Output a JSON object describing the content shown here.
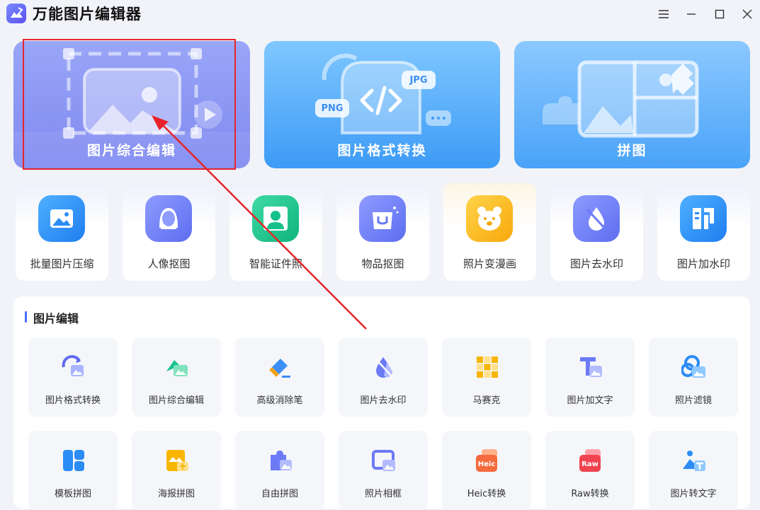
{
  "app": {
    "title": "万能图片编辑器"
  },
  "hero": [
    {
      "label": "图片综合编辑"
    },
    {
      "label": "图片格式转换",
      "badges": [
        "PNG",
        "JPG"
      ]
    },
    {
      "label": "拼图"
    }
  ],
  "tools": [
    {
      "label": "批量图片压缩",
      "icon": "image-compress-icon",
      "color": "#2b8cf5"
    },
    {
      "label": "人像抠图",
      "icon": "portrait-cutout-icon",
      "color": "#6b7af5"
    },
    {
      "label": "智能证件照",
      "icon": "id-photo-icon",
      "color": "#16c08a"
    },
    {
      "label": "物品抠图",
      "icon": "object-cutout-icon",
      "color": "#6b7af5"
    },
    {
      "label": "照片变漫画",
      "icon": "cartoon-bear-icon",
      "color": "#fbb918"
    },
    {
      "label": "图片去水印",
      "icon": "remove-watermark-icon",
      "color": "#6b7af5"
    },
    {
      "label": "图片加水印",
      "icon": "add-watermark-icon",
      "color": "#2b8cf5"
    }
  ],
  "section": {
    "title": "图片编辑",
    "row1": [
      {
        "label": "图片格式转换",
        "icon": "format-convert-icon"
      },
      {
        "label": "图片综合编辑",
        "icon": "comprehensive-edit-icon"
      },
      {
        "label": "高级消除笔",
        "icon": "eraser-pen-icon"
      },
      {
        "label": "图片去水印",
        "icon": "remove-watermark-icon"
      },
      {
        "label": "马赛克",
        "icon": "mosaic-icon"
      },
      {
        "label": "图片加文字",
        "icon": "add-text-icon"
      },
      {
        "label": "照片滤镜",
        "icon": "filter-icon"
      }
    ],
    "row2": [
      {
        "label": "模板拼图",
        "icon": "template-collage-icon"
      },
      {
        "label": "海报拼图",
        "icon": "poster-collage-icon"
      },
      {
        "label": "自由拼图",
        "icon": "free-collage-icon"
      },
      {
        "label": "照片相框",
        "icon": "photo-frame-icon"
      },
      {
        "label": "Heic转换",
        "icon": "heic-icon",
        "badge": "Heic"
      },
      {
        "label": "Raw转换",
        "icon": "raw-icon",
        "badge": "Raw"
      },
      {
        "label": "图片转文字",
        "icon": "image-to-text-icon"
      }
    ]
  }
}
